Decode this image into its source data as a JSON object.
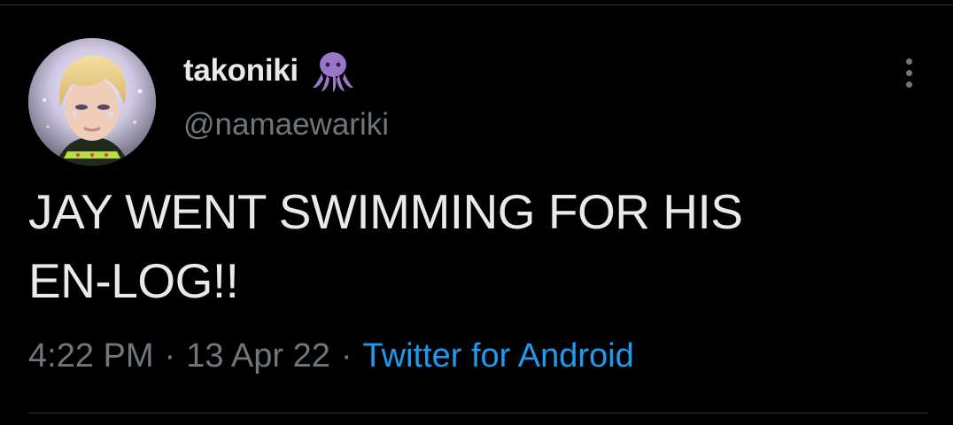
{
  "tweet": {
    "author": {
      "display_name": "takoniki",
      "handle": "@namaewariki",
      "name_emoji": "octopus-icon",
      "avatar": "profile-photo"
    },
    "text": "JAY WENT SWIMMING FOR HIS\nEN-LOG!!",
    "time": "4:22 PM",
    "separator": "·",
    "date": "13 Apr 22",
    "source": "Twitter for Android"
  },
  "colors": {
    "background": "#000000",
    "primary_text": "#e7e9ea",
    "secondary_text": "#71767b",
    "link": "#1d9bf0",
    "divider": "#2f3336",
    "emoji_purple": "#9a76c9"
  },
  "icons": {
    "more": "more-options-icon"
  }
}
